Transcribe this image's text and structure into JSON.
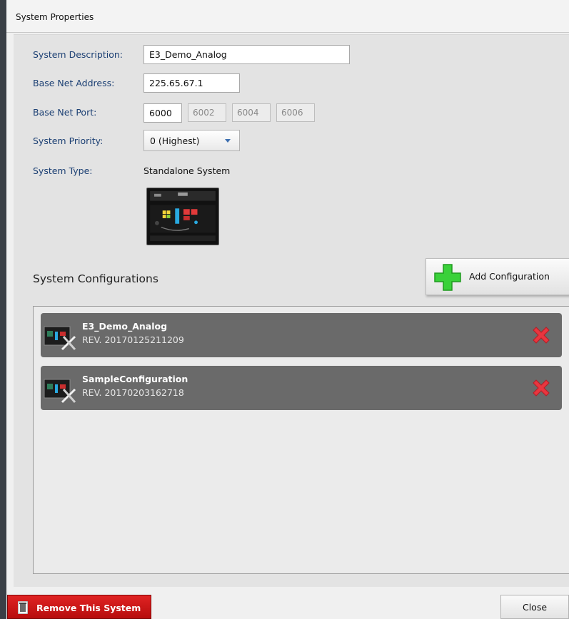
{
  "window": {
    "title": "System Properties"
  },
  "form": {
    "description_label": "System Description:",
    "description_value": "E3_Demo_Analog",
    "address_label": "Base Net Address:",
    "address_value": "225.65.67.1",
    "port_label": "Base Net Port:",
    "port_value": "6000",
    "port_derived": [
      "6002",
      "6004",
      "6006"
    ],
    "priority_label": "System Priority:",
    "priority_value": "0 (Highest)",
    "type_label": "System Type:",
    "type_value": "Standalone System"
  },
  "configurations": {
    "section_title": "System Configurations",
    "add_label": "Add Configuration",
    "items": [
      {
        "name": "E3_Demo_Analog",
        "rev": "REV. 20170125211209"
      },
      {
        "name": "SampleConfiguration",
        "rev": "REV. 20170203162718"
      }
    ]
  },
  "footer": {
    "remove_label": "Remove This System",
    "close_label": "Close"
  },
  "colors": {
    "label_blue": "#1b3f73",
    "row_gray": "#6a6a6a",
    "remove_red": "#c81717",
    "delete_red": "#e8363f",
    "add_green": "#3ad13a"
  },
  "icons": [
    "plus-icon",
    "delete-icon",
    "trash-icon",
    "dropdown-arrow-icon",
    "config-thumbnail-icon",
    "system-device-image"
  ]
}
